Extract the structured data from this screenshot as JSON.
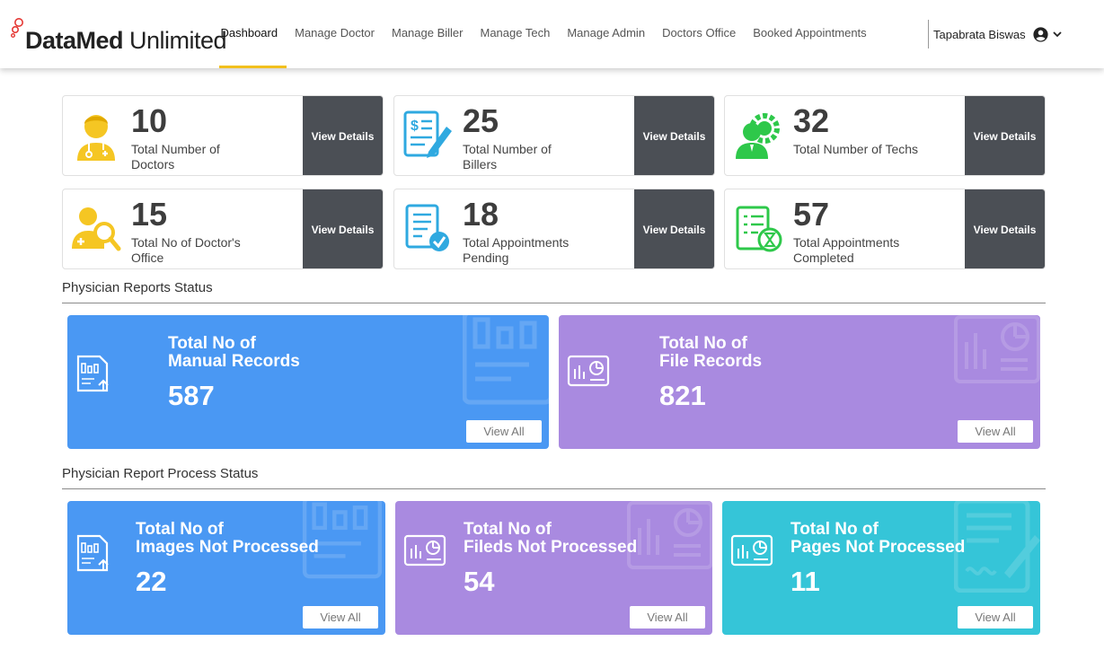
{
  "brand": {
    "bold": "DataMed",
    "light": " Unlimited"
  },
  "nav": [
    {
      "label": "Dashboard",
      "active": true
    },
    {
      "label": "Manage Doctor"
    },
    {
      "label": "Manage Biller"
    },
    {
      "label": "Manage Tech"
    },
    {
      "label": "Manage Admin"
    },
    {
      "label": "Doctors Office"
    },
    {
      "label": "Booked Appointments"
    }
  ],
  "user": {
    "name": "Tapabrata Biswas"
  },
  "stats": [
    {
      "value": "10",
      "label": "Total Number of Doctors",
      "button": "View Details",
      "icon": "doctor-icon"
    },
    {
      "value": "25",
      "label": "Total Number of Billers",
      "button": "View Details",
      "icon": "biller-invoice-icon"
    },
    {
      "value": "32",
      "label": "Total Number of Techs",
      "button": "View Details",
      "icon": "tech-gear-icon"
    },
    {
      "value": "15",
      "label": "Total No of Doctor's Office",
      "button": "View Details",
      "icon": "doctor-search-icon"
    },
    {
      "value": "18",
      "label": "Total Appointments Pending",
      "button": "View Details",
      "icon": "checklist-check-icon"
    },
    {
      "value": "57",
      "label": "Total Appointments Completed",
      "button": "View Details",
      "icon": "checklist-hourglass-icon"
    }
  ],
  "sections": {
    "reports": "Physician Reports Status",
    "process": "Physician Report Process Status"
  },
  "report_cards": [
    {
      "title": "Total No of\nManual Records",
      "value": "587",
      "button": "View All"
    },
    {
      "title": "Total No of\nFile Records",
      "value": "821",
      "button": "View All"
    }
  ],
  "process_cards": [
    {
      "title": "Total No of\nImages Not Processed",
      "value": "22",
      "button": "View All"
    },
    {
      "title": "Total No of\nFileds Not Processed",
      "value": "54",
      "button": "View All"
    },
    {
      "title": "Total No of\nPages Not Processed",
      "value": "11",
      "button": "View All"
    }
  ],
  "colors": {
    "accent": "#f2c01e",
    "dark_button": "#4b4f55",
    "blue": "#4a98f3",
    "purple": "#a98ae0",
    "teal": "#35c5d8",
    "icon_yellow": "#f5c623",
    "icon_blue": "#2fa9e0",
    "icon_green": "#2ec84a"
  }
}
